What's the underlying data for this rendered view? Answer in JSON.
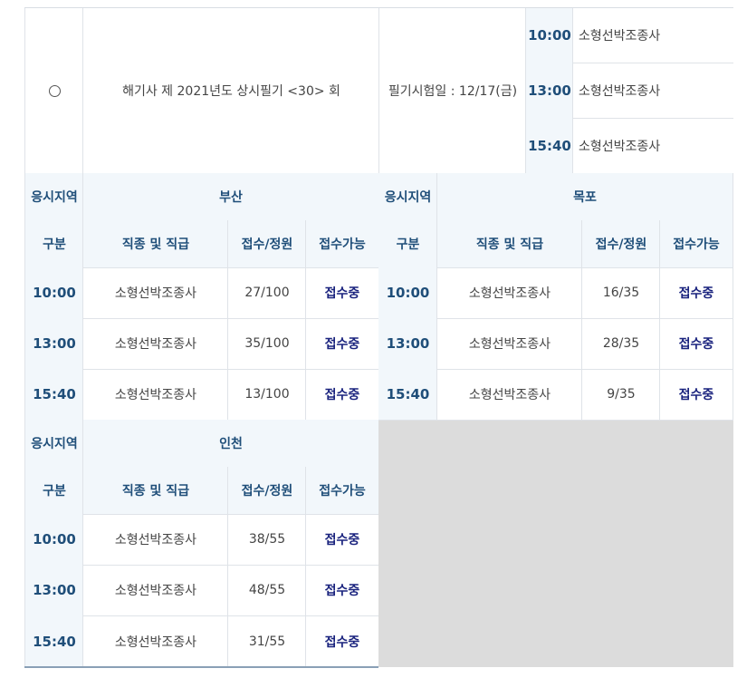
{
  "exam": {
    "title": "해기사 제 2021년도 상시필기 <30> 회",
    "date_label": "필기시험일 : 12/17(금)",
    "sessions": [
      {
        "time": "10:00",
        "job": "소형선박조종사"
      },
      {
        "time": "13:00",
        "job": "소형선박조종사"
      },
      {
        "time": "15:40",
        "job": "소형선박조종사"
      }
    ]
  },
  "headers": {
    "region_label": "응시지역",
    "col_type": "구분",
    "col_job": "직종 및 직급",
    "col_count": "접수/정원",
    "col_avail": "접수가능"
  },
  "regions": [
    {
      "name": "부산",
      "rows": [
        {
          "time": "10:00",
          "job": "소형선박조종사",
          "count": "27/100",
          "status": "접수중"
        },
        {
          "time": "13:00",
          "job": "소형선박조종사",
          "count": "35/100",
          "status": "접수중"
        },
        {
          "time": "15:40",
          "job": "소형선박조종사",
          "count": "13/100",
          "status": "접수중"
        }
      ]
    },
    {
      "name": "목포",
      "rows": [
        {
          "time": "10:00",
          "job": "소형선박조종사",
          "count": "16/35",
          "status": "접수중"
        },
        {
          "time": "13:00",
          "job": "소형선박조종사",
          "count": "28/35",
          "status": "접수중"
        },
        {
          "time": "15:40",
          "job": "소형선박조종사",
          "count": "9/35",
          "status": "접수중"
        }
      ]
    },
    {
      "name": "인천",
      "rows": [
        {
          "time": "10:00",
          "job": "소형선박조종사",
          "count": "38/55",
          "status": "접수중"
        },
        {
          "time": "13:00",
          "job": "소형선박조종사",
          "count": "48/55",
          "status": "접수중"
        },
        {
          "time": "15:40",
          "job": "소형선박조종사",
          "count": "31/55",
          "status": "접수중"
        }
      ]
    }
  ]
}
